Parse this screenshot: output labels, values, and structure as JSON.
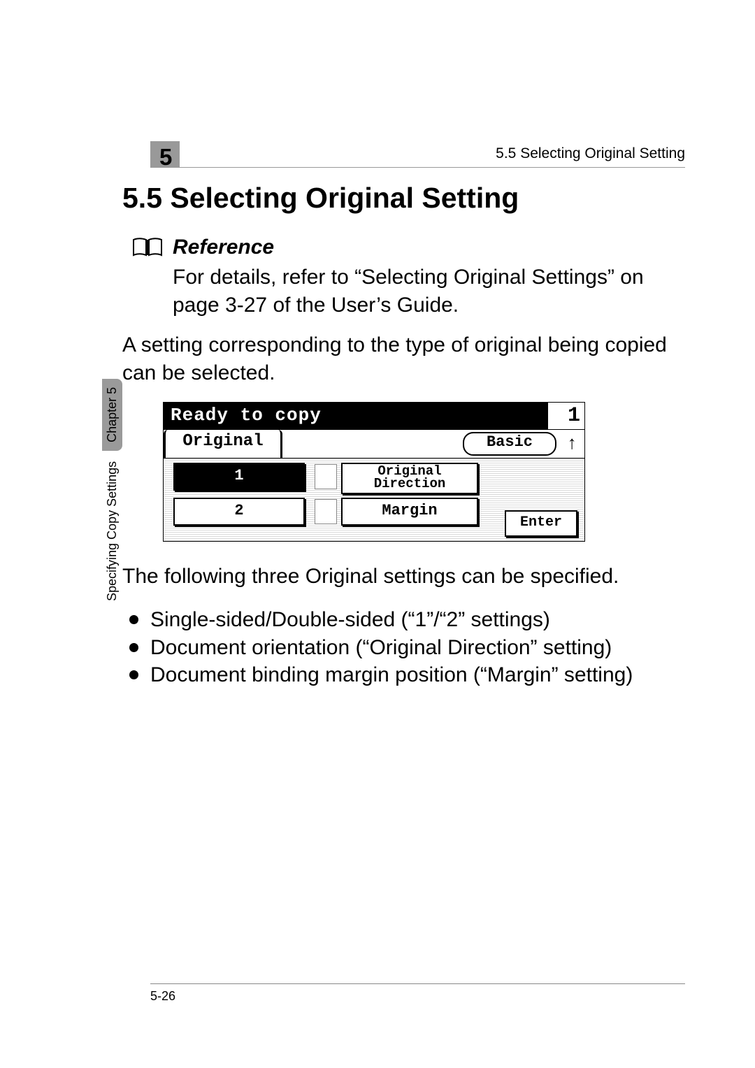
{
  "header": {
    "chapter_number": "5",
    "running_head": "5.5 Selecting Original Setting"
  },
  "section_title": "5.5  Selecting Original Setting",
  "reference": {
    "label": "Reference",
    "body": "For details, refer to “Selecting Original Settings” on page 3-27 of the User’s Guide."
  },
  "intro": "A setting corresponding to the type of original being copied can be selected.",
  "lcd": {
    "status": "Ready to copy",
    "count": "1",
    "tab_original": "Original",
    "basic_btn": "Basic",
    "up_arrow": "↑",
    "opt1": "1",
    "opt2": "2",
    "orig_dir_line1": "Original",
    "orig_dir_line2": "Direction",
    "margin": "Margin",
    "enter": "Enter"
  },
  "followup": "The following three Original settings can be specified.",
  "bullets": [
    "Single-sided/Double-sided (“1”/“2” settings)",
    "Document orientation (“Original Direction” setting)",
    "Document binding margin position (“Margin” setting)"
  ],
  "side": {
    "section": "Specifying Copy Settings",
    "chapter": "Chapter 5"
  },
  "page_number": "5-26"
}
